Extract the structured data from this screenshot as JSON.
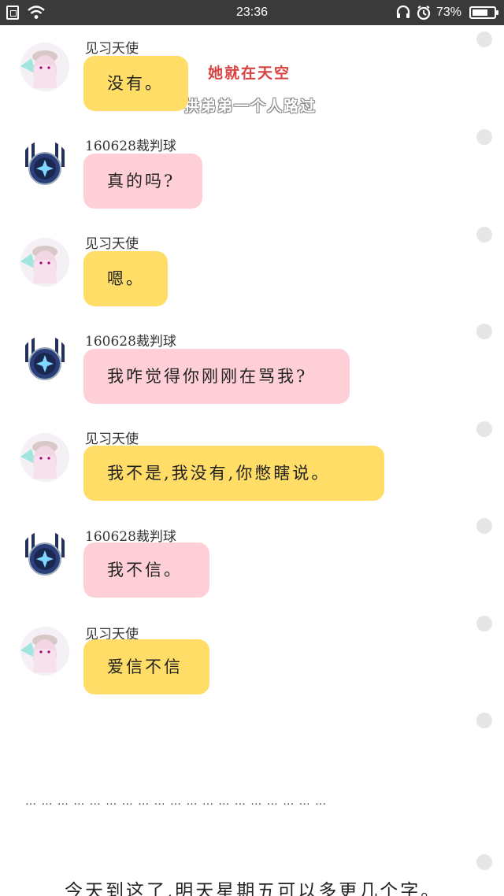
{
  "status_bar": {
    "time": "23:36",
    "battery_percent": "73%",
    "battery_level": 0.73,
    "icons": [
      "sim-icon",
      "wifi-icon",
      "headset-icon",
      "alarm-icon",
      "battery-icon"
    ]
  },
  "watermark": {
    "title": "她就在天空",
    "subtitle": "拱弟弟一个人路过"
  },
  "messages": [
    {
      "sender": "见习天使",
      "text": "没有。",
      "color": "#ffdd66"
    },
    {
      "sender": "160628裁判球",
      "text": "真的吗?",
      "color": "#ffcfd8"
    },
    {
      "sender": "见习天使",
      "text": "嗯。",
      "color": "#ffdd66"
    },
    {
      "sender": "160628裁判球",
      "text": "我咋觉得你刚刚在骂我?",
      "color": "#ffcfd8"
    },
    {
      "sender": "见习天使",
      "text": "我不是,我没有,你憋瞎说。",
      "color": "#ffdd66"
    },
    {
      "sender": "160628裁判球",
      "text": "我不信。",
      "color": "#ffcfd8"
    },
    {
      "sender": "见习天使",
      "text": "爱信不信",
      "color": "#ffdd66"
    }
  ],
  "ellipsis": "… … … … … … … … … … … … … … … … … … …",
  "footer_note": "今天到这了,明天星期五可以多更几个字。"
}
